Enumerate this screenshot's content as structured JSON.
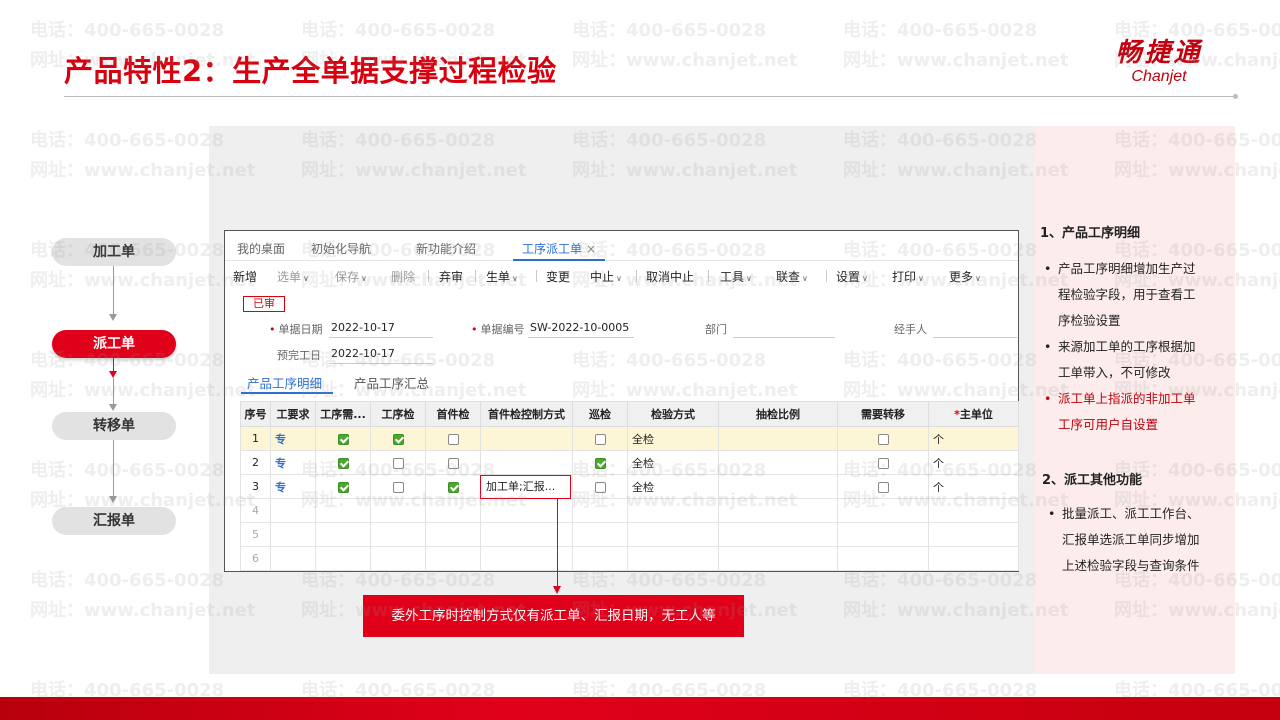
{
  "slide": {
    "title": "产品特性2：生产全单据支撑过程检验",
    "logo_cn": "畅捷通",
    "logo_en": "Chanjet"
  },
  "watermark": {
    "phone": "电话：400-665-0028",
    "site": "网址：www.chanjet.net"
  },
  "flow": {
    "nodes": [
      "加工单",
      "派工单",
      "转移单",
      "汇报单"
    ],
    "active_index": 1
  },
  "app": {
    "tabs": [
      {
        "label": "我的桌面"
      },
      {
        "label": "初始化导航"
      },
      {
        "label": "新功能介绍"
      },
      {
        "label": "工序派工单",
        "active": true
      }
    ],
    "close_glyph": "×",
    "toolbar": [
      {
        "label": "新增",
        "dim": false,
        "dropdown": false
      },
      {
        "label": "选单",
        "dim": true,
        "dropdown": true
      },
      {
        "label": "保存",
        "dim": true,
        "dropdown": true
      },
      {
        "label": "删除",
        "dim": true,
        "dropdown": false
      },
      {
        "label": "弃审",
        "dim": false,
        "dropdown": false
      },
      {
        "label": "生单",
        "dim": false,
        "dropdown": true
      },
      {
        "label": "变更",
        "dim": false,
        "dropdown": false
      },
      {
        "label": "中止",
        "dim": false,
        "dropdown": true
      },
      {
        "label": "取消中止",
        "dim": false,
        "dropdown": false
      },
      {
        "label": "工具",
        "dim": false,
        "dropdown": true
      },
      {
        "label": "联查",
        "dim": false,
        "dropdown": true
      },
      {
        "label": "设置",
        "dim": false,
        "dropdown": true
      },
      {
        "label": "打印",
        "dim": false,
        "dropdown": true
      },
      {
        "label": "更多",
        "dim": false,
        "dropdown": true
      }
    ],
    "status": "已审",
    "form": {
      "doc_date_label": "单据日期",
      "doc_date": "2022-10-17",
      "doc_no_label": "单据编号",
      "doc_no": "SW-2022-10-0005",
      "dept_label": "部门",
      "dept": "",
      "handler_label": "经手人",
      "handler": "",
      "finish_date_label": "预完工日",
      "finish_date": "2022-10-17"
    },
    "subtabs": [
      {
        "label": "产品工序明细",
        "active": true
      },
      {
        "label": "产品工序汇总",
        "active": false
      }
    ],
    "grid": {
      "columns": [
        "序号",
        "工要求",
        "工序需...",
        "工序检",
        "首件检",
        "首件检控制方式",
        "巡检",
        "检验方式",
        "抽检比例",
        "需要转移",
        "主单位"
      ],
      "rows": [
        {
          "no": "1",
          "req": "专",
          "need": true,
          "proc_check": true,
          "first": false,
          "first_ctrl": "",
          "patrol": false,
          "method": "全检",
          "ratio": "",
          "transfer": false,
          "unit": "个",
          "selected": true
        },
        {
          "no": "2",
          "req": "专",
          "need": true,
          "proc_check": false,
          "first": false,
          "first_ctrl": "",
          "patrol": true,
          "method": "全检",
          "ratio": "",
          "transfer": false,
          "unit": "个",
          "selected": false
        },
        {
          "no": "3",
          "req": "专",
          "need": true,
          "proc_check": false,
          "first": true,
          "first_ctrl": "加工单;汇报...",
          "patrol": false,
          "method": "全检",
          "ratio": "",
          "transfer": false,
          "unit": "个",
          "selected": false
        }
      ],
      "empty_rows": [
        "4",
        "5",
        "6"
      ]
    }
  },
  "callout": {
    "text": "委外工序时控制方式仅有派工单、汇报日期，无工人等"
  },
  "notes": {
    "section1_title": "1、产品工序明细",
    "section1_items": [
      {
        "text": "产品工序明细增加生产过程检验字段，用于查看工序检验设置",
        "lines": [
          "产品工序明细增加生产过",
          "程检验字段，用于查看工",
          "序检验设置"
        ],
        "red": false
      },
      {
        "text": "来源加工单的工序根据加工单带入，不可修改",
        "lines": [
          "来源加工单的工序根据加",
          "工单带入，不可修改"
        ],
        "red": false
      },
      {
        "text": "派工单上指派的非加工单工序可用户自设置",
        "lines": [
          "派工单上指派的非加工单",
          "工序可用户自设置"
        ],
        "red": true
      }
    ],
    "section2_title": "2、派工其他功能",
    "section2_items": [
      {
        "lines": [
          "批量派工、派工工作台、",
          "汇报单选派工单同步增加",
          "上述检验字段与查询条件"
        ],
        "red": false
      }
    ]
  },
  "colors": {
    "brand_red": "#e0001a",
    "accent_blue": "#2b6fd6",
    "check_green": "#4aa82d"
  }
}
